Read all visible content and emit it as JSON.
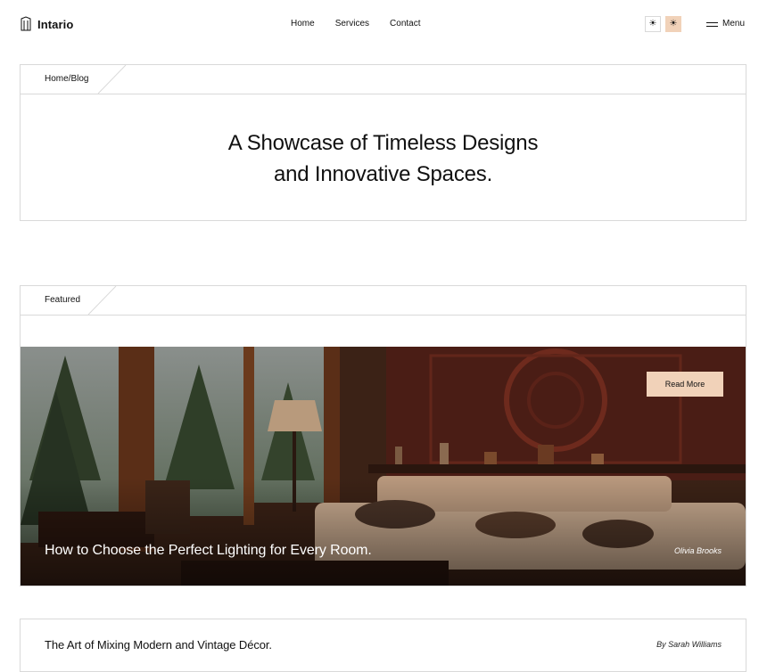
{
  "header": {
    "logo_text": "Intario",
    "nav": [
      "Home",
      "Services",
      "Contact"
    ],
    "theme_light_icon": "☀",
    "theme_dark_icon": "☀",
    "menu_label": "Menu"
  },
  "hero": {
    "breadcrumb": "Home/Blog",
    "title_line1": "A Showcase of Timeless Designs",
    "title_line2": "and Innovative Spaces."
  },
  "featured": {
    "label": "Featured",
    "read_more": "Read More",
    "title": "How to Choose the Perfect Lighting for Every Room.",
    "author": "Olivia Brooks"
  },
  "posts": [
    {
      "title": "The Art of Mixing Modern and Vintage Décor.",
      "author": "By Sarah Williams"
    }
  ],
  "colors": {
    "accent": "#f1d2b9",
    "border": "#d9d9d9",
    "text": "#111111"
  }
}
